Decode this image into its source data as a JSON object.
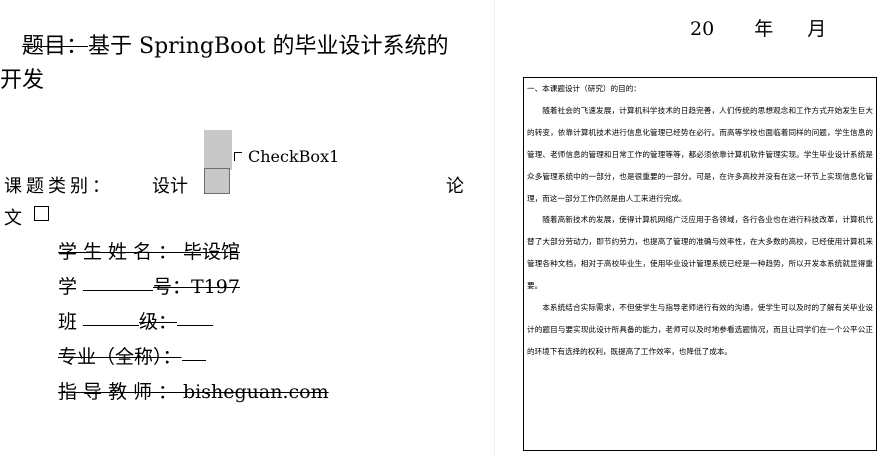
{
  "left_page": {
    "title_prefix": "题目：",
    "title_main": "基于 SpringBoot 的毕业设计系统的",
    "title_cont": "开发",
    "checkbox_label": "CheckBox1",
    "category_label": "课题类别：",
    "category_design": "设计",
    "category_thesis_part1": "论",
    "category_thesis_part2": "文",
    "fields": {
      "name_label": "学生姓名：",
      "name_value": "毕设馆",
      "number_label_1": "学",
      "number_label_2": "号：",
      "number_value": "T197",
      "class_label_1": "班",
      "class_label_2": "级：",
      "major_label": "专业（全称）：",
      "teacher_label": "指导教师：",
      "teacher_value": "bisheguan.com"
    }
  },
  "right_page": {
    "date_year_num": "20",
    "date_year": "年",
    "date_month": "月",
    "section_heading": "一、本课题设计（研究）的目的：",
    "paragraphs": [
      "随着社会的飞速发展，计算机科学技术的日趋完善，人们传统的思想观念和工作方式开始发生巨大的转变，依靠计算机技术进行信息化管理已经势在必行。而高等学校也面临着同样的问题，学生信息的管理、老师信息的管理和日常工作的管理等等，都必须依靠计算机软件管理实现。学生毕业设计系统是众多管理系统中的一部分，也是很重要的一部分。可是，在许多高校并没有在这一环节上实现信息化管理，而这一部分工作仍然是由人工来进行完成。",
      "随着高新技术的发展，使得计算机网络广泛应用于各领域，各行各业也在进行科技改革，计算机代替了大部分劳动力，即节约劳力，也提高了管理的准确与效率性，在大多数的高校，已经使用计算机来管理各种文档，相对于高校毕业生，使用毕业设计管理系统已经是一种趋势，所以开发本系统就显得重要。",
      "本系统结合实际需求，不但使学生与指导老师进行有效的沟通，使学生可以及时的了解有关毕业设计的题目与要实现此设计所具备的能力，老师可以及时地参看选题情况，而且让同学们在一个公平公正的环境下有选择的权利，既提高了工作效率，也降低了成本。"
    ]
  }
}
